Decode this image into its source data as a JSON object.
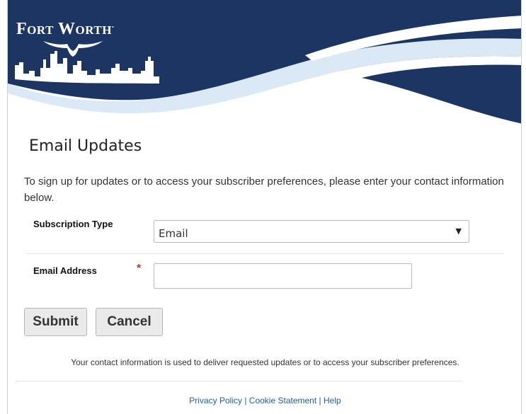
{
  "brand": {
    "logo_text": "Fort Worth",
    "logo_mark": ".",
    "colors": {
      "navy": "#1d3563",
      "light_blue": "#dbe9f6",
      "white": "#ffffff"
    }
  },
  "form": {
    "title": "Email Updates",
    "intro": "To sign up for updates or to access your subscriber preferences, please enter your contact information below.",
    "subscription_type_label": "Subscription Type",
    "subscription_type_value": "Email",
    "email_label": "Email Address",
    "required_marker": "*",
    "email_value": "",
    "submit_label": "Submit",
    "cancel_label": "Cancel",
    "privacy_note": "Your contact information is used to deliver requested updates or to access your subscriber preferences."
  },
  "footer": {
    "privacy_policy": "Privacy Policy",
    "cookie_statement": "Cookie Statement",
    "help": "Help",
    "separator": "|"
  },
  "icons": {
    "select_arrow": "chevron-down-icon"
  }
}
